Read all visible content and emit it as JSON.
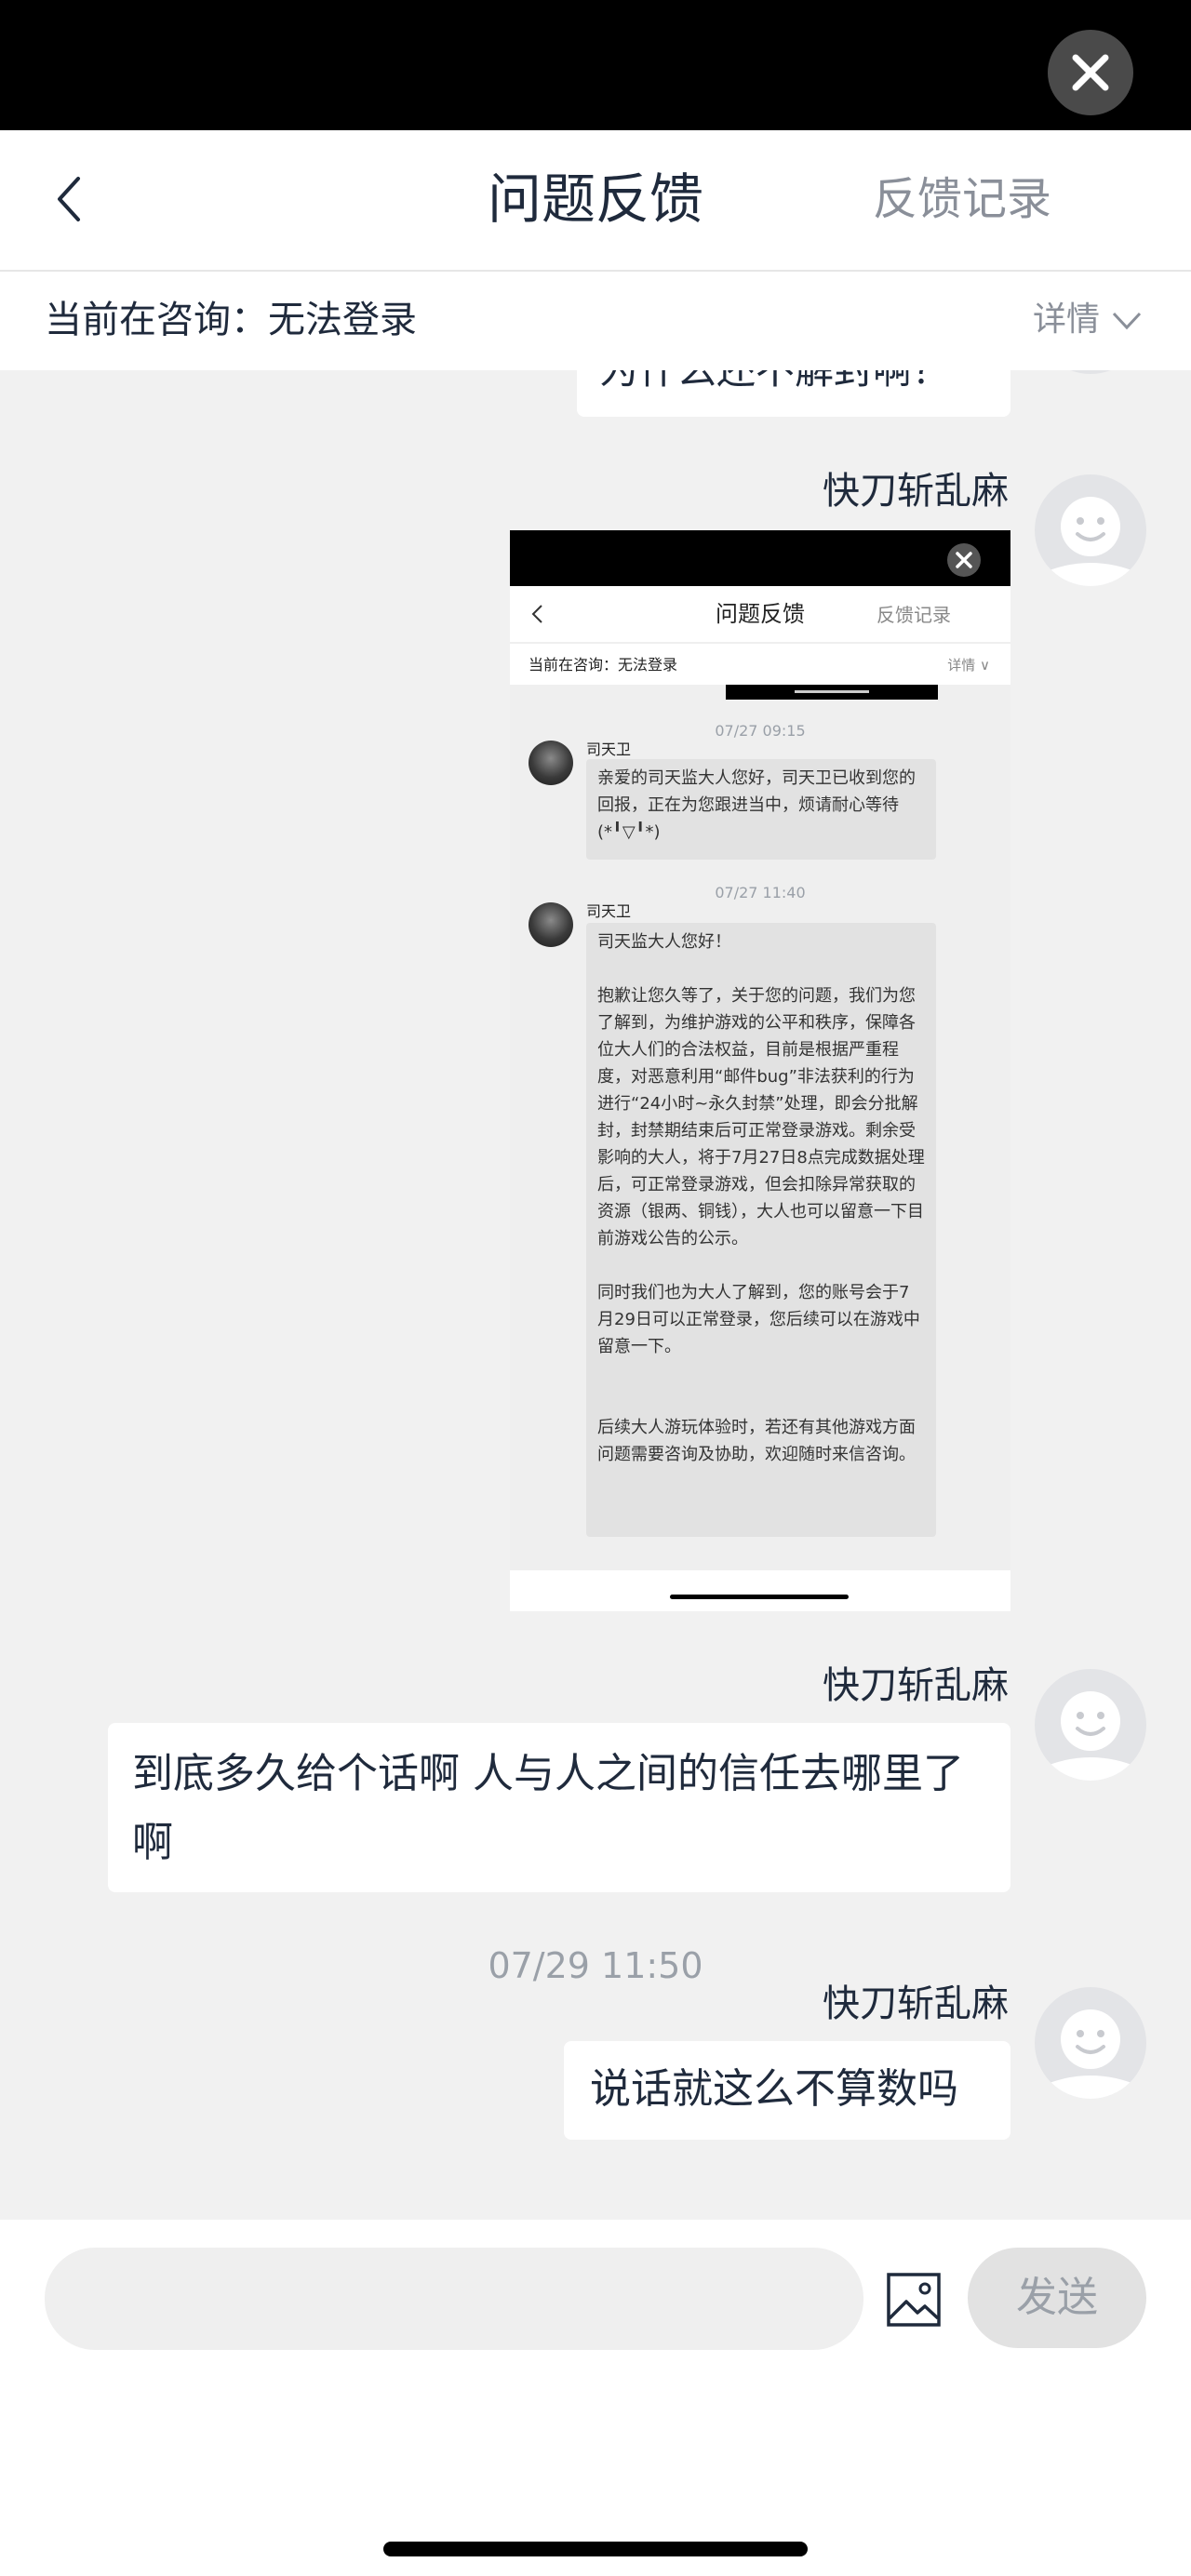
{
  "header": {
    "title": "问题反馈",
    "record_label": "反馈记录"
  },
  "consult": {
    "label": "当前在咨询：无法登录",
    "detail_label": "详情"
  },
  "messages": {
    "partial_top_text": "为什么还不解封啊？",
    "msg1_sender": "快刀斩乱麻",
    "msg2_sender": "快刀斩乱麻",
    "msg2_text": "到底多久给个话啊 人与人之间的信任去哪里了啊",
    "timestamp": "07/29 11:50",
    "msg3_sender": "快刀斩乱麻",
    "msg3_text": "说话就这么不算数吗"
  },
  "screenshot": {
    "title": "问题反馈",
    "record_label": "反馈记录",
    "consult_label": "当前在咨询：无法登录",
    "detail_label": "详情",
    "ts1": "07/27 09:15",
    "name1": "司天卫",
    "text1": "亲爱的司天监大人您好，司天卫已收到您的回报，正在为您跟进当中，烦请耐心等待(*╹▽╹*)",
    "ts2": "07/27 11:40",
    "name2": "司天卫",
    "text2": "司天监大人您好！\n\n抱歉让您久等了，关于您的问题，我们为您了解到，为维护游戏的公平和秩序，保障各位大人们的合法权益，目前是根据严重程度，对恶意利用“邮件bug”非法获利的行为进行“24小时~永久封禁”处理，即会分批解封，封禁期结束后可正常登录游戏。剩余受影响的大人，将于7月27日8点完成数据处理后，可正常登录游戏，但会扣除异常获取的资源（银两、铜钱），大人也可以留意一下目前游戏公告的公示。\n\n同时我们也为大人了解到，您的账号会于7月29日可以正常登录，您后续可以在游戏中留意一下。\n\n\n后续大人游玩体验时，若还有其他游戏方面问题需要咨询及协助，欢迎随时来信咨询。"
  },
  "input": {
    "placeholder": "",
    "send_label": "发送"
  },
  "icons": {
    "close": "close-icon",
    "back": "chevron-left-icon",
    "detail": "chevron-down-icon",
    "image": "image-icon",
    "avatar": "smiley-avatar-icon"
  }
}
